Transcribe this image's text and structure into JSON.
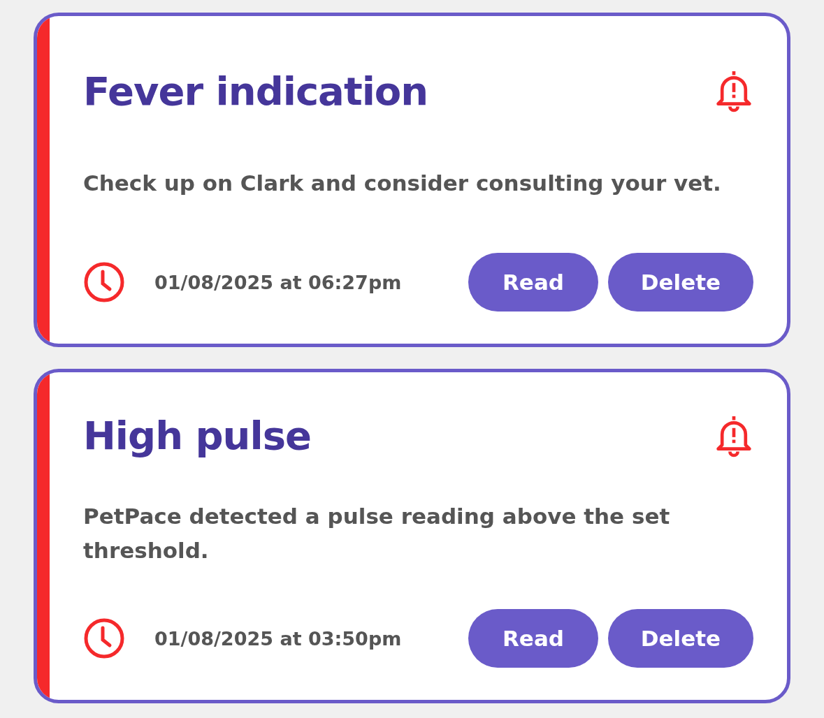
{
  "notifications": [
    {
      "title": "Fever indication",
      "message": "Check up on Clark and consider consulting your vet.",
      "time": "01/08/2025 at 06:27pm",
      "color": "#f5292b",
      "buttons": [
        "Read",
        "Delete"
      ]
    },
    {
      "title": "High pulse",
      "message": "PetPace detected a pulse reading above the set threshold.",
      "time": "01/08/2025 at 03:50pm",
      "color": "#f5292b",
      "buttons": [
        "Read",
        "Delete"
      ]
    }
  ]
}
